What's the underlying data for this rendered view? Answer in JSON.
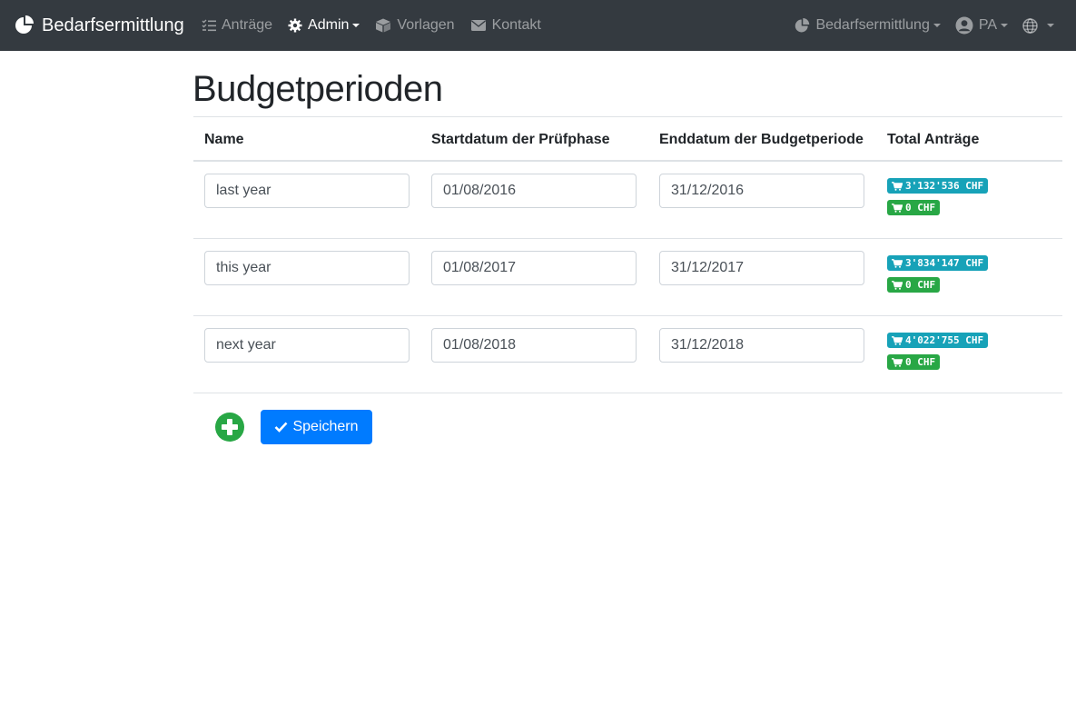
{
  "navbar": {
    "brand": "Bedarfsermittlung",
    "brand_icon": "pie-chart-icon",
    "items": [
      {
        "label": "Anträge",
        "icon": "list-check-icon"
      },
      {
        "label": "Admin",
        "icon": "gear-icon"
      },
      {
        "label": "Vorlagen",
        "icon": "box-icon"
      },
      {
        "label": "Kontakt",
        "icon": "envelope-icon"
      }
    ],
    "right": {
      "app_switch": "Bedarfsermittlung",
      "user": "PA",
      "language_icon": "globe-icon"
    }
  },
  "page": {
    "title": "Budgetperioden"
  },
  "table": {
    "headers": [
      "Name",
      "Startdatum der Prüfphase",
      "Enddatum der Budgetperiode",
      "Total Anträge"
    ],
    "rows": [
      {
        "name": "last year",
        "start": "01/08/2016",
        "end": "31/12/2016",
        "total_info": "3'132'536 CHF",
        "total_success": "0 CHF"
      },
      {
        "name": "this year",
        "start": "01/08/2017",
        "end": "31/12/2017",
        "total_info": "3'834'147 CHF",
        "total_success": "0 CHF"
      },
      {
        "name": "next year",
        "start": "01/08/2018",
        "end": "31/12/2018",
        "total_info": "4'022'755 CHF",
        "total_success": "0 CHF"
      }
    ]
  },
  "actions": {
    "save_label": "Speichern"
  },
  "colors": {
    "navbar_bg": "#343a40",
    "badge_info": "#17a2b8",
    "badge_success": "#28a745",
    "primary": "#007bff"
  }
}
